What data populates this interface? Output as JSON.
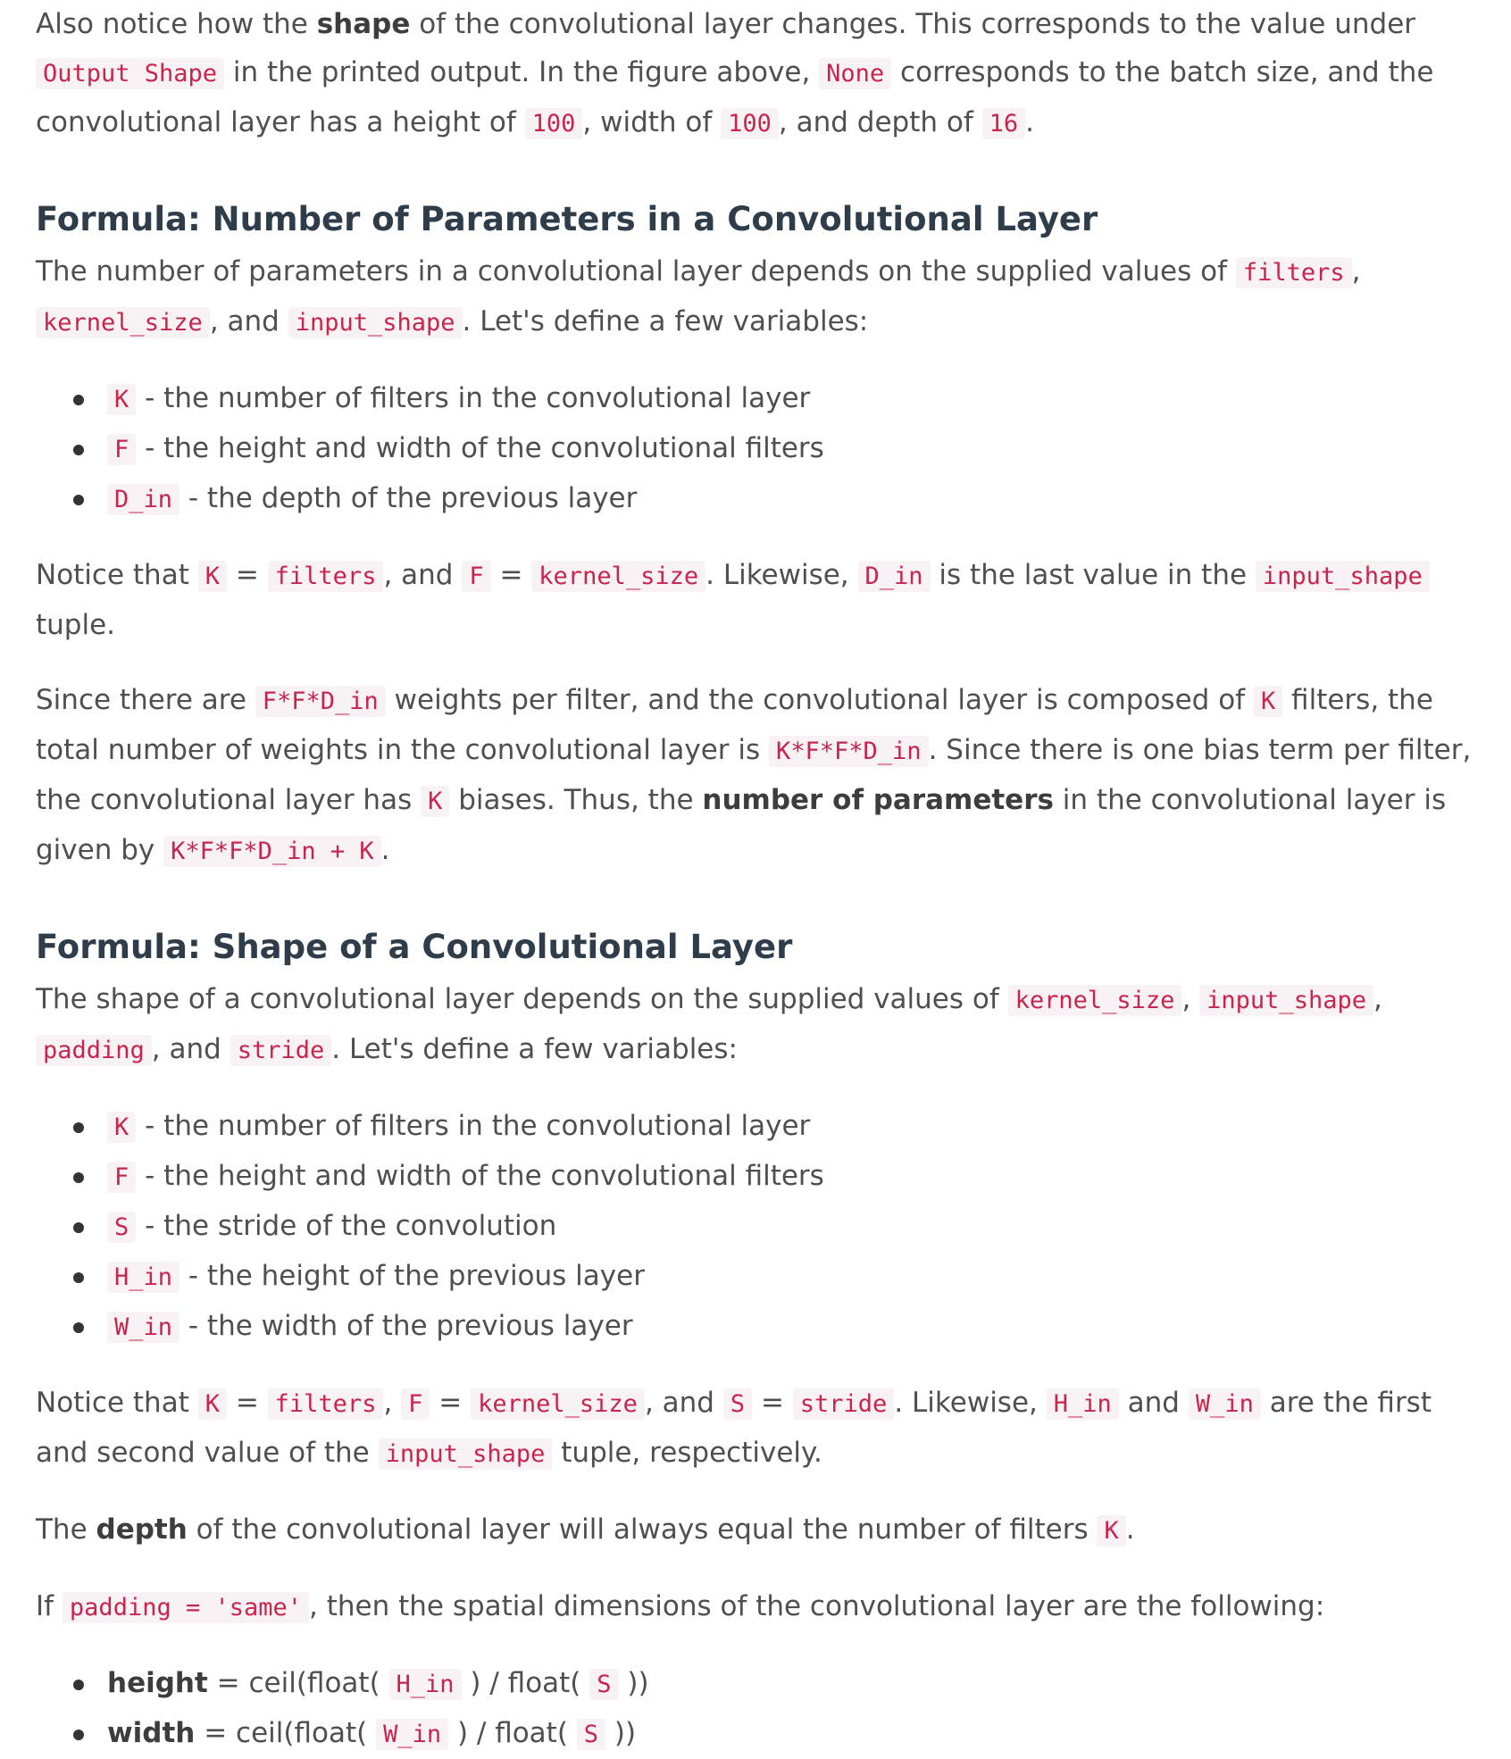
{
  "intro": {
    "t1": "Also notice how the ",
    "b1": "shape",
    "t2": " of the convolutional layer changes. This corresponds to the value under ",
    "c1": "Output Shape",
    "t3": " in the printed output. In the figure above, ",
    "c2": "None",
    "t4": " corresponds to the batch size, and the convolutional layer has a height of ",
    "c3": "100",
    "t5": ", width of ",
    "c4": "100",
    "t6": ", and depth of ",
    "c5": "16",
    "t7": "."
  },
  "params_section": {
    "heading": "Formula: Number of Parameters in a Convolutional Layer",
    "p1": {
      "t1": "The number of parameters in a convolutional layer depends on the supplied values of ",
      "c1": "filters",
      "t2": ", ",
      "c2": "kernel_size",
      "t3": ", and ",
      "c3": "input_shape",
      "t4": ". Let's define a few variables:"
    },
    "vars": [
      {
        "code": "K",
        "text": " - the number of filters in the convolutional layer"
      },
      {
        "code": "F",
        "text": " - the height and width of the convolutional filters"
      },
      {
        "code": "D_in",
        "text": " - the depth of the previous layer"
      }
    ],
    "p2": {
      "t1": "Notice that ",
      "c1": "K",
      "t2": " = ",
      "c2": "filters",
      "t3": ", and ",
      "c3": "F",
      "t4": " = ",
      "c4": "kernel_size",
      "t5": ". Likewise, ",
      "c5": "D_in",
      "t6": " is the last value in the ",
      "c6": "input_shape",
      "t7": " tuple."
    },
    "p3": {
      "t1": "Since there are ",
      "c1": "F*F*D_in",
      "t2": " weights per filter, and the convolutional layer is composed of ",
      "c2": "K",
      "t3": " filters, the total number of weights in the convolutional layer is ",
      "c3": "K*F*F*D_in",
      "t4": ". Since there is one bias term per filter, the convolutional layer has ",
      "c4": "K",
      "t5": " biases. Thus, the ",
      "b1": "number of parameters",
      "t6": " in the convolutional layer is given by ",
      "c5": "K*F*F*D_in + K",
      "t7": "."
    }
  },
  "shape_section": {
    "heading": "Formula: Shape of a Convolutional Layer",
    "p1": {
      "t1": "The shape of a convolutional layer depends on the supplied values of ",
      "c1": "kernel_size",
      "t2": ", ",
      "c2": "input_shape",
      "t3": ", ",
      "c3": "padding",
      "t4": ", and ",
      "c4": "stride",
      "t5": ". Let's define a few variables:"
    },
    "vars": [
      {
        "code": "K",
        "text": " - the number of filters in the convolutional layer"
      },
      {
        "code": "F",
        "text": " - the height and width of the convolutional filters"
      },
      {
        "code": "S",
        "text": " - the stride of the convolution"
      },
      {
        "code": "H_in",
        "text": " - the height of the previous layer"
      },
      {
        "code": "W_in",
        "text": " - the width of the previous layer"
      }
    ],
    "p2": {
      "t1": "Notice that ",
      "c1": "K",
      "t2": " = ",
      "c2": "filters",
      "t3": ", ",
      "c3": "F",
      "t4": " = ",
      "c4": "kernel_size",
      "t5": ", and ",
      "c5": "S",
      "t6": " = ",
      "c6": "stride",
      "t7": ". Likewise, ",
      "c7": "H_in",
      "t8": " and ",
      "c8": "W_in",
      "t9": " are the first and second value of the ",
      "c9": "input_shape",
      "t10": " tuple, respectively."
    },
    "p3": {
      "t1": "The ",
      "b1": "depth",
      "t2": " of the convolutional layer will always equal the number of filters ",
      "c1": "K",
      "t3": "."
    },
    "p4": {
      "t1": "If ",
      "c1": "padding = 'same'",
      "t2": ", then the spatial dimensions of the convolutional layer are the following:"
    },
    "dims": [
      {
        "label": "height",
        "t1": " = ceil(float( ",
        "code": "H_in",
        "t2": " ) / float( ",
        "code2": "S",
        "t3": " ))"
      },
      {
        "label": "width",
        "t1": " = ceil(float( ",
        "code": "W_in",
        "t2": " ) / float( ",
        "code2": "S",
        "t3": " ))"
      }
    ]
  }
}
